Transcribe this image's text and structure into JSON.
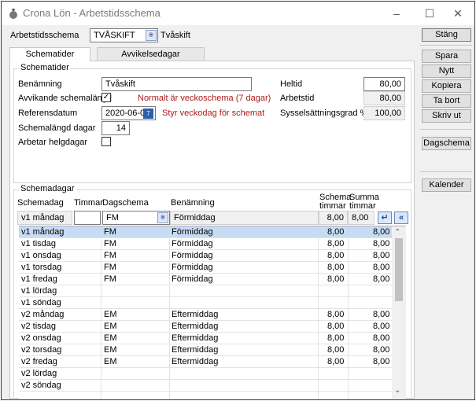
{
  "window": {
    "title": "Crona Lön - Arbetstidsschema"
  },
  "header": {
    "label": "Arbetstidsschema",
    "code": "TVÅSKIFT",
    "name": "Tvåskift"
  },
  "buttons": {
    "close": "Stäng",
    "save": "Spara",
    "new": "Nytt",
    "copy": "Kopiera",
    "delete": "Ta bort",
    "print": "Skriv ut",
    "day_schedule": "Dagschema",
    "calendar": "Kalender"
  },
  "tabs": [
    {
      "label": "Schematider",
      "active": true
    },
    {
      "label": "Avvikelsedagar",
      "active": false
    }
  ],
  "schematider": {
    "group_title": "Schematider",
    "benamning_label": "Benämning",
    "benamning_value": "Tvåskift",
    "avvikande_label": "Avvikande schemalängd",
    "avvikande_checked": true,
    "avvikande_note": "Normalt är veckoschema (7 dagar)",
    "referensdatum_label": "Referensdatum",
    "referensdatum_value": "2020-06-01",
    "referensdatum_note": "Styr veckodag för schemat",
    "schemalangd_label": "Schemalängd dagar",
    "schemalangd_value": "14",
    "helgdagar_label": "Arbetar helgdagar",
    "helgdagar_checked": false,
    "heltid_label": "Heltid",
    "heltid_value": "80,00",
    "arbetstid_label": "Arbetstid",
    "arbetstid_value": "80,00",
    "syssel_label": "Sysselsättningsgrad %",
    "syssel_value": "100,00"
  },
  "schemadagar": {
    "group_title": "Schemadagar",
    "columns": {
      "schemadag": "Schemadag",
      "timmar": "Timmar",
      "dagschema": "Dagschema",
      "benamning": "Benämning",
      "schema_timmar_1": "Schema",
      "schema_timmar_2": "timmar",
      "summa_timmar_1": "Summa",
      "summa_timmar_2": "timmar"
    },
    "edit_row": {
      "schemadag": "v1 måndag",
      "timmar": "",
      "dagschema": "FM",
      "benamning": "Förmiddag",
      "schema_timmar": "8,00",
      "summa_timmar": "8,00"
    },
    "rows": [
      {
        "schemadag": "v1 måndag",
        "dagschema": "FM",
        "benamning": "Förmiddag",
        "schema": "8,00",
        "summa": "8,00"
      },
      {
        "schemadag": "v1 tisdag",
        "dagschema": "FM",
        "benamning": "Förmiddag",
        "schema": "8,00",
        "summa": "8,00"
      },
      {
        "schemadag": "v1 onsdag",
        "dagschema": "FM",
        "benamning": "Förmiddag",
        "schema": "8,00",
        "summa": "8,00"
      },
      {
        "schemadag": "v1 torsdag",
        "dagschema": "FM",
        "benamning": "Förmiddag",
        "schema": "8,00",
        "summa": "8,00"
      },
      {
        "schemadag": "v1 fredag",
        "dagschema": "FM",
        "benamning": "Förmiddag",
        "schema": "8,00",
        "summa": "8,00"
      },
      {
        "schemadag": "v1 lördag",
        "dagschema": "",
        "benamning": "",
        "schema": "",
        "summa": ""
      },
      {
        "schemadag": "v1 söndag",
        "dagschema": "",
        "benamning": "",
        "schema": "",
        "summa": ""
      },
      {
        "schemadag": "v2 måndag",
        "dagschema": "EM",
        "benamning": "Eftermiddag",
        "schema": "8,00",
        "summa": "8,00"
      },
      {
        "schemadag": "v2 tisdag",
        "dagschema": "EM",
        "benamning": "Eftermiddag",
        "schema": "8,00",
        "summa": "8,00"
      },
      {
        "schemadag": "v2 onsdag",
        "dagschema": "EM",
        "benamning": "Eftermiddag",
        "schema": "8,00",
        "summa": "8,00"
      },
      {
        "schemadag": "v2 torsdag",
        "dagschema": "EM",
        "benamning": "Eftermiddag",
        "schema": "8,00",
        "summa": "8,00"
      },
      {
        "schemadag": "v2 fredag",
        "dagschema": "EM",
        "benamning": "Eftermiddag",
        "schema": "8,00",
        "summa": "8,00"
      },
      {
        "schemadag": "v2 lördag",
        "dagschema": "",
        "benamning": "",
        "schema": "",
        "summa": ""
      },
      {
        "schemadag": "v2 söndag",
        "dagschema": "",
        "benamning": "",
        "schema": "",
        "summa": ""
      }
    ]
  }
}
